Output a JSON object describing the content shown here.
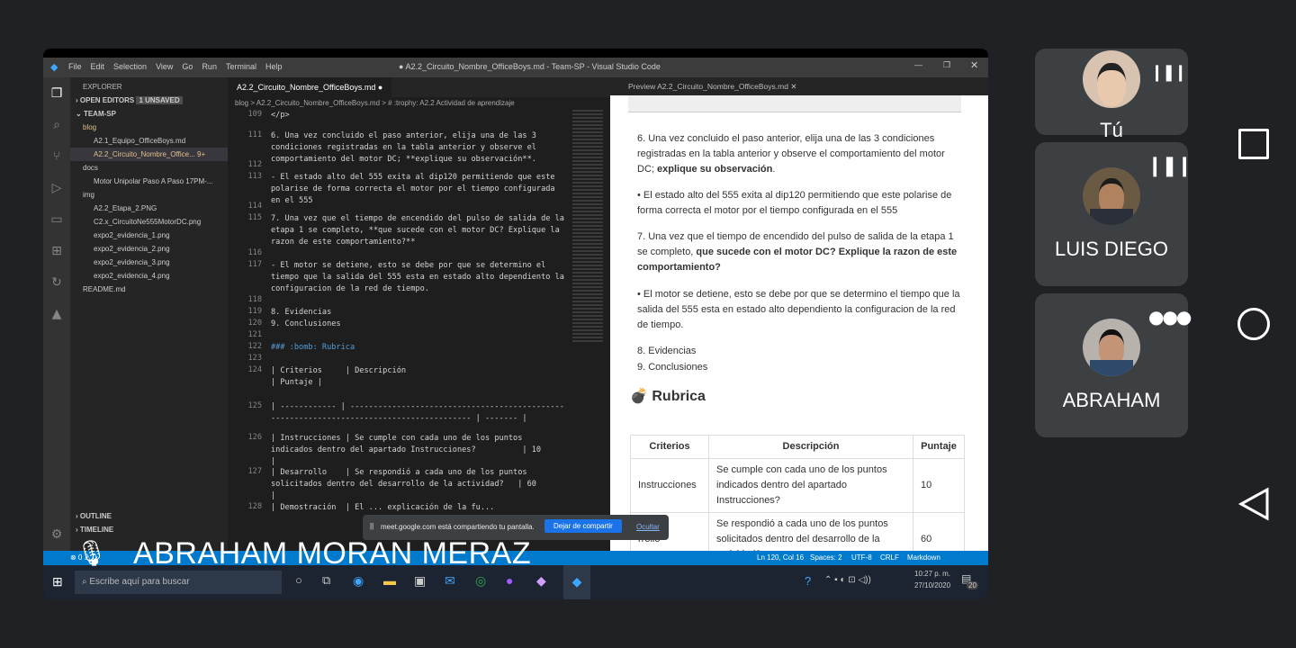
{
  "window": {
    "title": "● A2.2_Circuito_Nombre_OfficeBoys.md - Team-SP - Visual Studio Code",
    "menu": [
      "File",
      "Edit",
      "Selection",
      "View",
      "Go",
      "Run",
      "Terminal",
      "Help"
    ]
  },
  "explorer": {
    "heading": "EXPLORER",
    "open_editors": "OPEN EDITORS",
    "unsaved": "1 UNSAVED",
    "team": "TEAM-SP",
    "rows": [
      {
        "label": "blog",
        "indent": 0
      },
      {
        "label": "A2.1_Equipo_OfficeBoys.md",
        "indent": 1
      },
      {
        "label": "A2.2_Circuito_Nombre_Office...  9+",
        "indent": 1
      },
      {
        "label": "docs",
        "indent": 0
      },
      {
        "label": "Motor Unipolar Paso A Paso 17PM-...",
        "indent": 1
      },
      {
        "label": "img",
        "indent": 0
      },
      {
        "label": "A2.2_Etapa_2.PNG",
        "indent": 1
      },
      {
        "label": "C2.x_CircuitoNe555MotorDC.png",
        "indent": 1
      },
      {
        "label": "expo2_evidencia_1.png",
        "indent": 1
      },
      {
        "label": "expo2_evidencia_2.png",
        "indent": 1
      },
      {
        "label": "expo2_evidencia_3.png",
        "indent": 1
      },
      {
        "label": "expo2_evidencia_4.png",
        "indent": 1
      },
      {
        "label": "README.md",
        "indent": 0
      }
    ],
    "outline": "OUTLINE",
    "timeline": "TIMELINE"
  },
  "editor": {
    "tab": "A2.2_Circuito_Nombre_OfficeBoys.md ●",
    "breadcrumb": "blog > A2.2_Circuito_Nombre_OfficeBoys.md > # :trophy: A2.2 Actividad de aprendizaje",
    "lines": [
      {
        "n": "109",
        "t": "</p>"
      },
      {
        "n": "111",
        "t": "6. Una vez concluido el paso anterior, elija una de las 3 condiciones registradas en la tabla anterior y observe el comportamiento del motor DC; **explique su observación**."
      },
      {
        "n": "112",
        "t": ""
      },
      {
        "n": "113",
        "t": "- El estado alto del 555 exita al dip120 permitiendo que este polarise de forma correcta el motor por el tiempo configurada en el 555"
      },
      {
        "n": "114",
        "t": ""
      },
      {
        "n": "115",
        "t": "7. Una vez que el tiempo de encendido del pulso de salida de la etapa 1 se completo, **que sucede con el motor DC? Explique la razon de este comportamiento?**"
      },
      {
        "n": "116",
        "t": ""
      },
      {
        "n": "117",
        "t": "- El motor se detiene, esto se debe por que se determino el tiempo que la salida del 555 esta en estado alto dependiento la configuracion de la red de tiempo."
      },
      {
        "n": "118",
        "t": ""
      },
      {
        "n": "119",
        "t": "8. Evidencias"
      },
      {
        "n": "120",
        "t": "9. Conclusiones"
      },
      {
        "n": "121",
        "t": ""
      },
      {
        "n": "122",
        "t": "### :bomb: Rubrica"
      },
      {
        "n": "123",
        "t": ""
      },
      {
        "n": "124",
        "t": "| Criterios     | Descripción                                              | Puntaje |"
      },
      {
        "n": "125",
        "t": "| ------------ | ----------------------------------------------------------------------------------------- | ------- |"
      },
      {
        "n": "126",
        "t": "| Instrucciones | Se cumple con cada uno de los puntos indicados dentro del apartado Instrucciones?          | 10      |"
      },
      {
        "n": "127",
        "t": "| Desarrollo    | Se respondió a cada uno de los puntos solicitados dentro del desarrollo de la actividad?   | 60      |"
      },
      {
        "n": "128",
        "t": "| Demostración  | El ... explicación de la fu..."
      }
    ]
  },
  "preview": {
    "tab": "Preview A2.2_Circuito_Nombre_OfficeBoys.md",
    "q6": "6. Una vez concluido el paso anterior, elija una de las 3 condiciones registradas en la tabla anterior y observe el comportamiento del motor DC; ",
    "q6b": "explique su observación",
    "a6": "El estado alto del 555 exita al dip120 permitiendo que este polarise de forma correcta el motor por el tiempo configurada en el 555",
    "q7": "7. Una vez que el tiempo de encendido del pulso de salida de la etapa 1 se completo, ",
    "q7b": "que sucede con el motor DC? Explique la razon de este comportamiento?",
    "a7": "El motor se detiene, esto se debe por que se determino el tiempo que la salida del 555 esta en estado alto dependiento la configuracion de la red de tiempo.",
    "e8": "8. Evidencias",
    "e9": "9. Conclusiones",
    "rubrica": "Rubrica",
    "table": {
      "headers": [
        "Criterios",
        "Descripción",
        "Puntaje"
      ],
      "rows": [
        [
          "Instrucciones",
          "Se cumple con cada uno de los puntos indicados dentro del apartado Instrucciones?",
          "10"
        ],
        [
          "rrollo",
          "Se respondió a cada uno de los puntos solicitados dentro del desarrollo de la actividad?",
          "60"
        ]
      ]
    }
  },
  "status": {
    "left": "⊗ 0 ⚠ 0",
    "pos": "Ln 120, Col 16",
    "spaces": "Spaces: 2",
    "enc": "UTF-8",
    "eol": "CRLF",
    "lang": "Markdown"
  },
  "taskbar": {
    "search": "Escribe aquí para buscar",
    "time": "10:27 p. m.",
    "date": "27/10/2020",
    "notif": "20"
  },
  "share_toast": {
    "text": "meet.google.com está compartiendo tu pantalla.",
    "stop": "Dejar de compartir",
    "hide": "Ocultar"
  },
  "presenter": "ABRAHAM MORAN MERAZ",
  "participants": [
    {
      "name": "Tú"
    },
    {
      "name": "LUIS DIEGO"
    },
    {
      "name": "ABRAHAM"
    }
  ],
  "colors": {
    "vscode_blue": "#007acc",
    "meet_bg": "#202124",
    "tile": "#3c4043"
  }
}
